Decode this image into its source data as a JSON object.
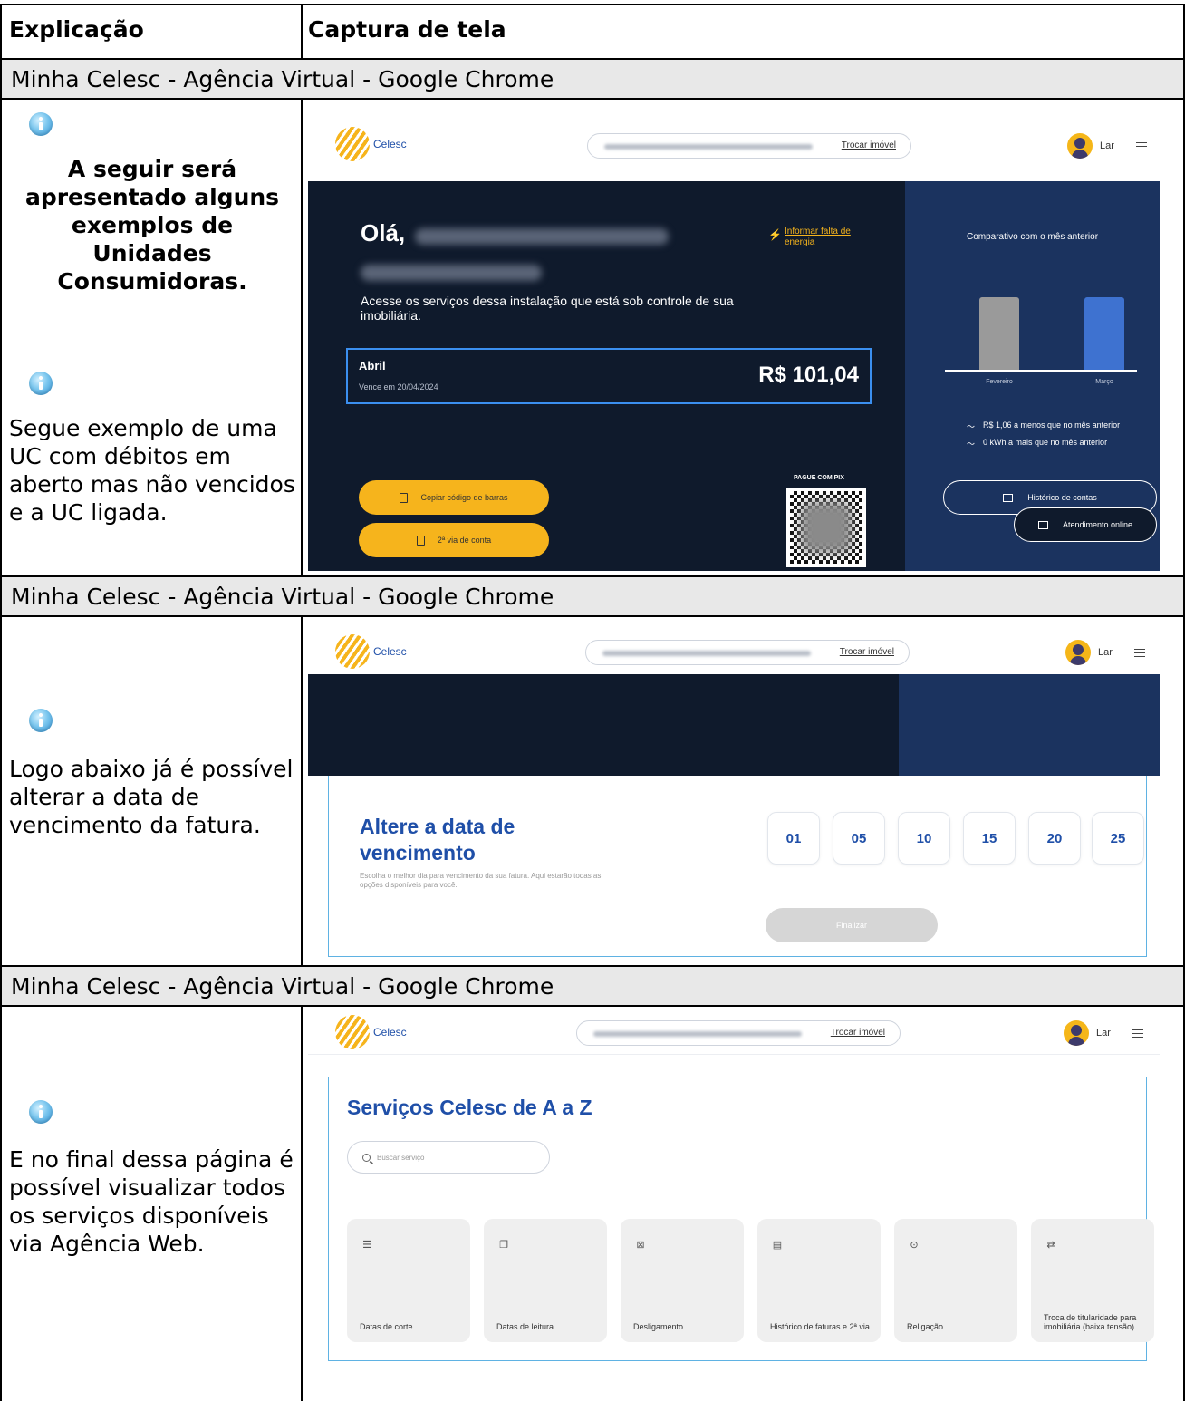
{
  "table": {
    "col1_header": "Explicação",
    "col2_header": "Captura de tela",
    "section_title": "Minha Celesc - Agência Virtual - Google Chrome"
  },
  "rows": [
    {
      "section_title": "Minha Celesc - Agência Virtual - Google Chrome",
      "explanation_bold": "A seguir será apresentado alguns exemplos de Unidades Consumidoras.",
      "explanation": "Segue exemplo de uma UC com débitos em aberto mas não vencidos e a UC ligada."
    },
    {
      "section_title": "Minha Celesc - Agência Virtual - Google Chrome",
      "explanation": "Logo abaixo já é possível alterar a data de vencimento da fatura."
    },
    {
      "section_title": "Minha Celesc - Agência Virtual - Google Chrome",
      "explanation": "E no final dessa página é possível visualizar todos os serviços disponíveis via Agência Web."
    }
  ],
  "app": {
    "logo_text": "Celesc",
    "change_property_link": "Trocar imóvel",
    "user_name": "Lar",
    "colors": {
      "brand_yellow": "#f6b41c",
      "brand_blue": "#1f4fa8",
      "dark_navy": "#0f1a2c",
      "panel_blue": "#1b335f"
    }
  },
  "screen1": {
    "greeting": "Olá,",
    "outage_link": "Informar falta de energia",
    "subtitle": "Acesse os serviços dessa instalação que está sob controle de sua imobiliária.",
    "bill_month": "Abril",
    "bill_due": "Vence em 20/04/2024",
    "bill_amount": "R$ 101,04",
    "copy_barcode_button": "Copiar código de barras",
    "second_copy_button": "2ª via de conta",
    "pix_label": "PAGUE COM PIX",
    "comparison_title": "Comparativo com o mês anterior",
    "bar_prev_label": "Fevereiro",
    "bar_curr_label": "Março",
    "stat_money": "R$ 1,06 a menos que no mês anterior",
    "stat_kwh": "0 kWh a mais que no mês anterior",
    "history_button": "Histórico de contas",
    "online_button": "Atendimento online"
  },
  "screen2": {
    "title": "Altere a data de vencimento",
    "description": "Escolha o melhor dia para vencimento da sua fatura. Aqui estarão todas as opções disponíveis para você.",
    "days": [
      "01",
      "05",
      "10",
      "15",
      "20",
      "25"
    ],
    "finalize_button": "Finalizar"
  },
  "screen3": {
    "title": "Serviços Celesc de A a Z",
    "search_placeholder": "Buscar serviço",
    "services": [
      {
        "label": "Datas de corte",
        "icon": "list-icon"
      },
      {
        "label": "Datas de leitura",
        "icon": "document-icon"
      },
      {
        "label": "Desligamento",
        "icon": "power-off-icon"
      },
      {
        "label": "Histórico de faturas e 2ª via",
        "icon": "invoice-icon"
      },
      {
        "label": "Religação",
        "icon": "power-on-icon"
      },
      {
        "label": "Troca de titularidade para imobiliária (baixa tensão)",
        "icon": "swap-icon"
      }
    ]
  }
}
